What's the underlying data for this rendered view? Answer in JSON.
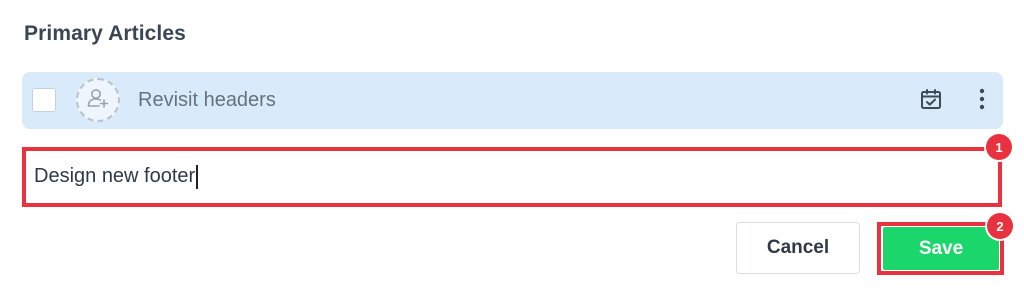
{
  "section": {
    "title": "Primary Articles"
  },
  "task": {
    "title": "Revisit headers",
    "checked": false,
    "icons": {
      "assign": "add-user-icon",
      "calendar": "calendar-check-icon",
      "more": "more-vertical-icon"
    }
  },
  "new_task": {
    "value": "Design new footer"
  },
  "annotations": {
    "badge_1": "1",
    "badge_2": "2"
  },
  "actions": {
    "cancel_label": "Cancel",
    "save_label": "Save"
  },
  "colors": {
    "row_bg": "#d9ebfb",
    "highlight": "#e8323f",
    "save": "#1bd66a",
    "title": "#3a4654"
  }
}
